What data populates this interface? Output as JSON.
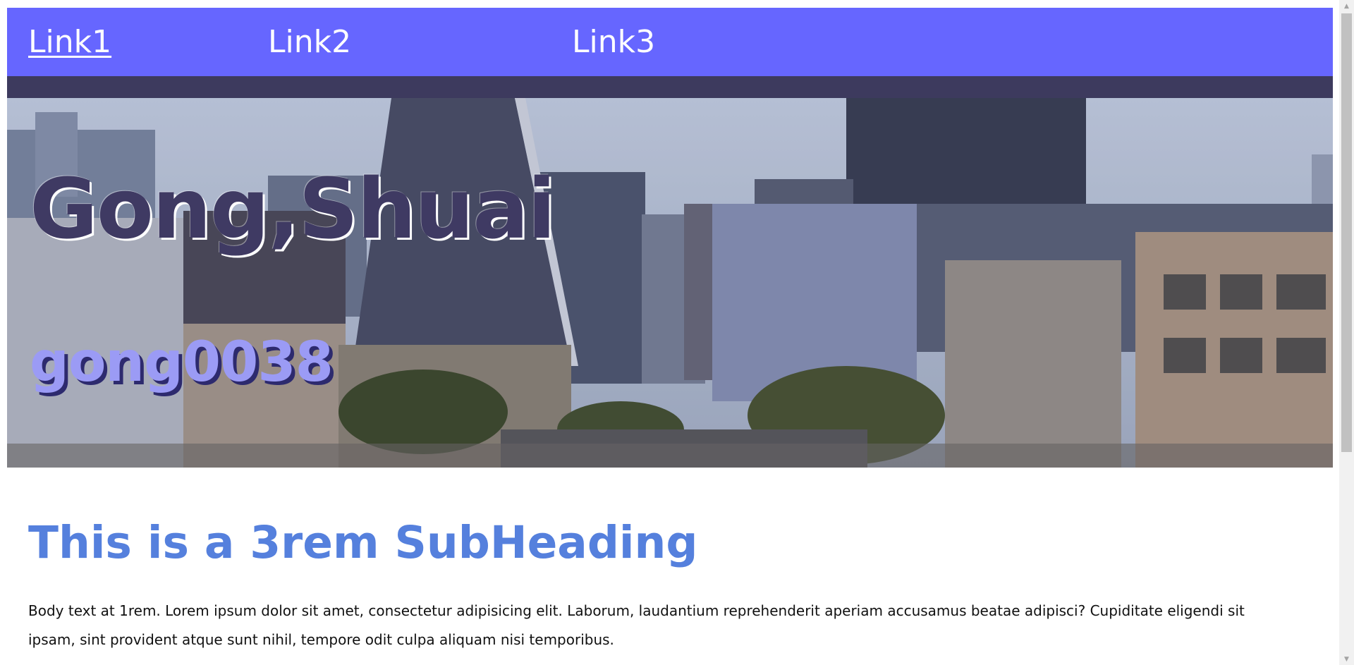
{
  "nav": {
    "links": [
      "Link1",
      "Link2",
      "Link3"
    ]
  },
  "hero": {
    "name": "Gong,Shuai",
    "username": "gong0038"
  },
  "content": {
    "subheading": "This is a 3rem SubHeading",
    "body": "Body text at 1rem. Lorem ipsum dolor sit amet, consectetur adipisicing elit. Laborum, laudantium reprehenderit aperiam accusamus beatae adipisci? Cupiditate eligendi sit ipsam, sint provident atque sunt nihil, tempore odit culpa aliquam nisi temporibus."
  },
  "colors": {
    "nav_bg": "#6666ff",
    "dark_bar": "#3d3a5e",
    "name_color": "#3f3a63",
    "username_color": "#9b9bf5",
    "subheading_color": "#5580dd"
  }
}
